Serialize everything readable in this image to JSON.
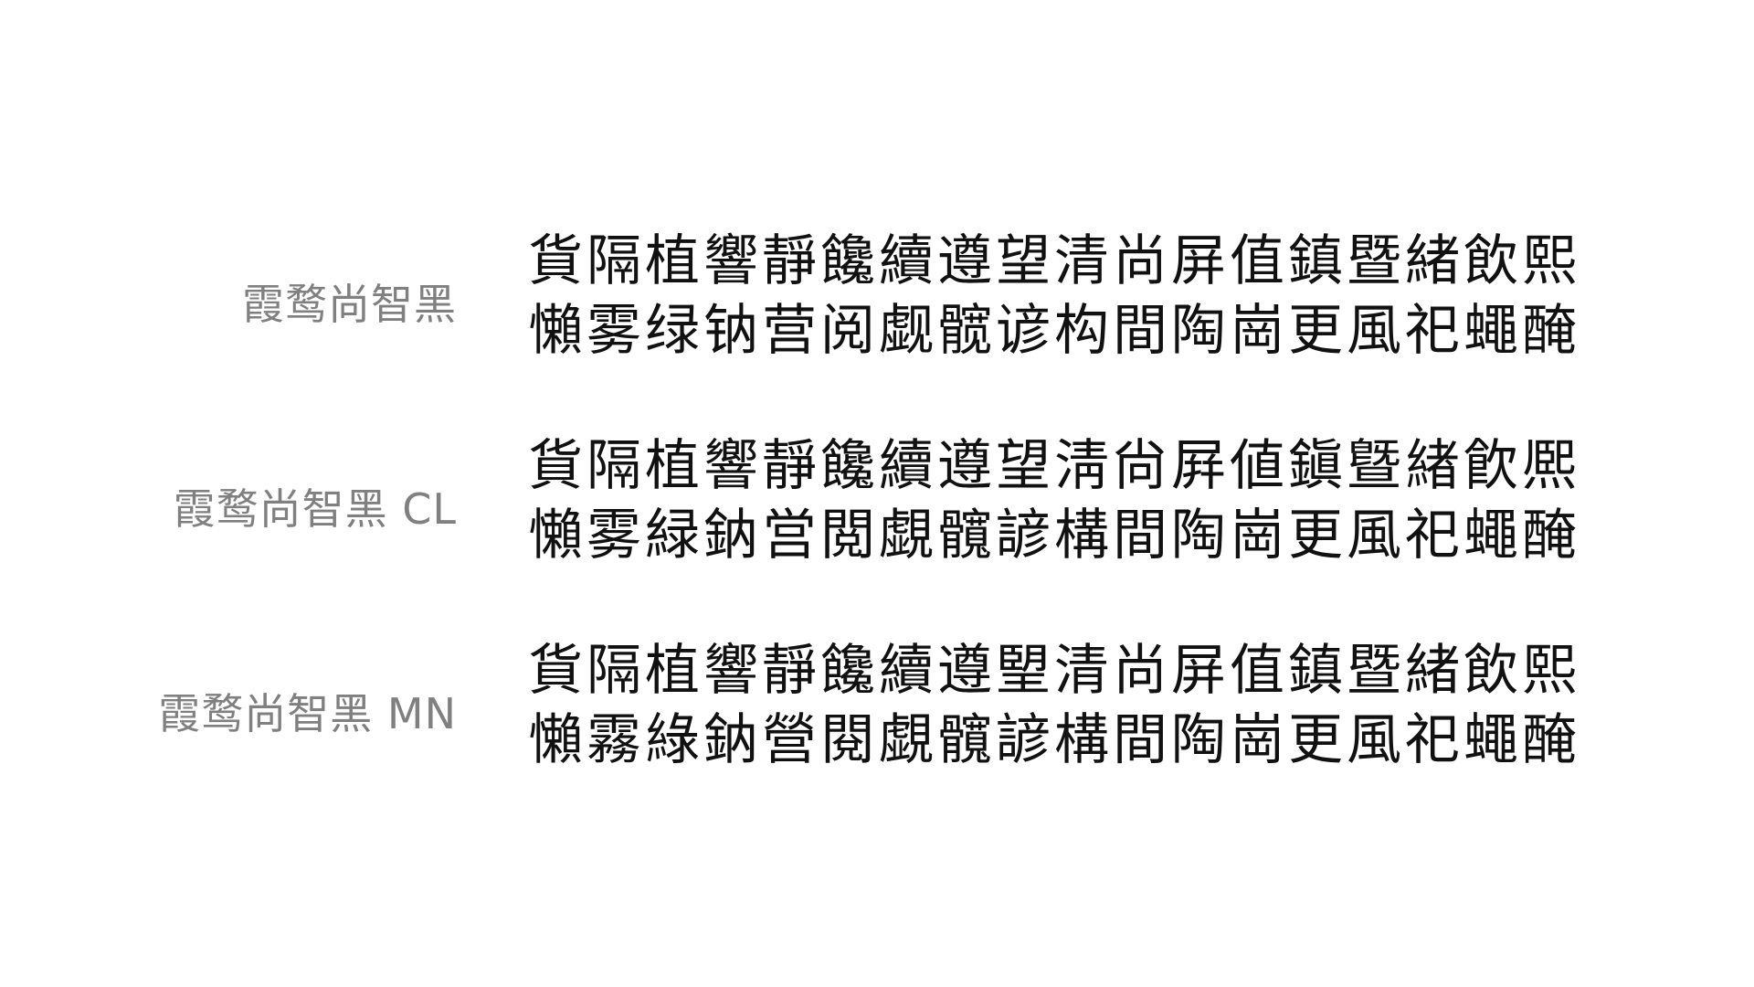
{
  "specimens": [
    {
      "font_name": "霞鹜尚智黑",
      "lines": [
        "貨隔植響靜饞續遵望清尚屏值鎮暨緒飲熙",
        "懶雾绿钠营阅觑髋谚构間陶崗更風祀蠅醃"
      ]
    },
    {
      "font_name": "霞鹜尚智黑 CL",
      "lines": [
        "貨隔植響靜饞續遵望淸尙屛値鎭曁緖飮熈",
        "懶雾緑鈉営閲覷髖諺構間陶崗更風祀蠅醃"
      ]
    },
    {
      "font_name": "霞鹜尚智黑 MN",
      "lines": [
        "貨隔植響靜饞續遵朢清尚屏值鎮暨緒飲熙",
        "懶霧綠鈉營閱覷髖諺構間陶崗更風祀蠅醃"
      ]
    }
  ]
}
